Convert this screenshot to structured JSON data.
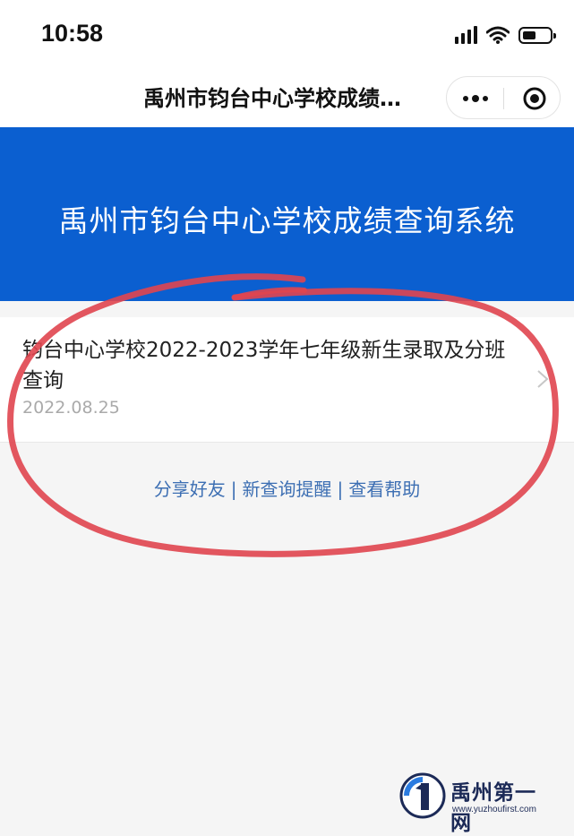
{
  "status_bar": {
    "time": "10:58"
  },
  "nav": {
    "title": "禹州市钧台中心学校成绩…"
  },
  "banner": {
    "title": "禹州市钧台中心学校成绩查询系统"
  },
  "list": {
    "items": [
      {
        "title": "钧台中心学校2022-2023学年七年级新生录取及分班查询",
        "date": "2022.08.25"
      }
    ]
  },
  "links": {
    "share": "分享好友",
    "reminder": "新查询提醒",
    "help": "查看帮助",
    "separator": "|"
  },
  "watermark": {
    "name": "禹州第一网",
    "url": "www.yuzhoufirst.com"
  },
  "colors": {
    "banner": "#0b5fd0",
    "link": "#3d6fb3",
    "annotation": "#e0454f"
  },
  "icons": [
    "signal-icon",
    "wifi-icon",
    "battery-icon",
    "more-icon",
    "target-icon",
    "chevron-right-icon"
  ]
}
